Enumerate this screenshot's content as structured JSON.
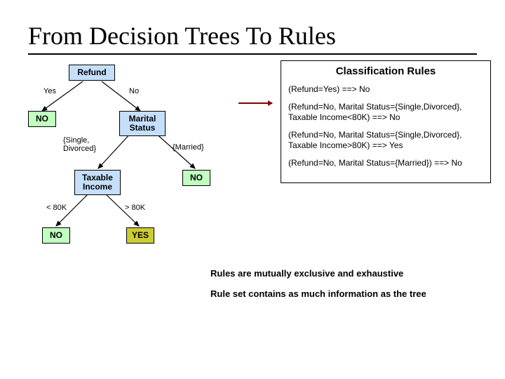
{
  "title": "From Decision Trees To Rules",
  "tree": {
    "refund": "Refund",
    "marital": "Marital Status",
    "taxable": "Taxable Income",
    "no": "NO",
    "yes": "YES",
    "edge_yes": "Yes",
    "edge_no": "No",
    "edge_single": "{Single, Divorced}",
    "edge_married": "{Married}",
    "edge_lt": "< 80K",
    "edge_gt": "> 80K"
  },
  "rules": {
    "heading": "Classification Rules",
    "r1": "(Refund=Yes) ==> No",
    "r2": "(Refund=No, Marital Status={Single,Divorced}, Taxable Income<80K) ==> No",
    "r3": "(Refund=No, Marital Status={Single,Divorced}, Taxable Income>80K) ==> Yes",
    "r4": "(Refund=No, Marital Status={Married}) ==> No"
  },
  "notes": {
    "line1": "Rules are mutually exclusive and exhaustive",
    "line2": "Rule set contains as much information as the tree"
  }
}
